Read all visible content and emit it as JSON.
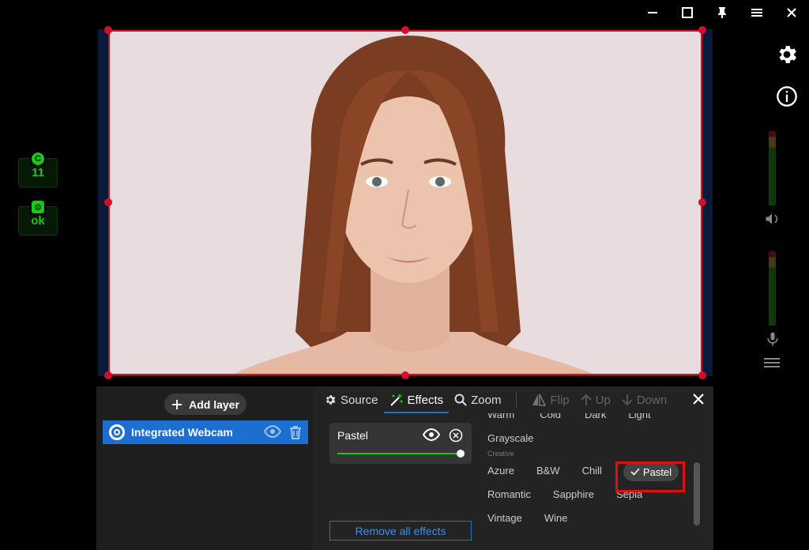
{
  "window": {
    "controls": [
      "minimize-icon",
      "maximize-icon",
      "pin-icon",
      "menu-icon",
      "close-icon"
    ]
  },
  "stats": {
    "counter": {
      "icon": "c-icon",
      "value": "11"
    },
    "status": {
      "icon": "gear-icon",
      "value": "ok"
    }
  },
  "sidebar": {
    "settings_icon": "gear-icon",
    "info_icon": "info-icon",
    "speaker_icon": "speaker-icon",
    "mic_icon": "mic-icon",
    "menu_icon": "menu-icon"
  },
  "panel": {
    "add_layer_label": "Add layer",
    "layer": {
      "name": "Integrated Webcam"
    },
    "tabs": {
      "source": "Source",
      "effects": "Effects",
      "zoom": "Zoom",
      "flip": "Flip",
      "up": "Up",
      "down": "Down"
    },
    "effect_card": {
      "name": "Pastel",
      "value": 1.0
    },
    "remove_all": "Remove all effects",
    "filters": {
      "top_row": [
        "Warm",
        "Cold",
        "Dark",
        "Light"
      ],
      "grayscale": "Grayscale",
      "creative_label": "Creative",
      "row1": [
        "Azure",
        "B&W",
        "Chill"
      ],
      "selected": "Pastel",
      "row2": [
        "Romantic",
        "Sapphire",
        "Sepia"
      ],
      "row3": [
        "Vintage",
        "Wine"
      ]
    }
  },
  "colors": {
    "accent": "#1c6fd1",
    "selection": "#d0102a",
    "ok": "#16c916"
  }
}
